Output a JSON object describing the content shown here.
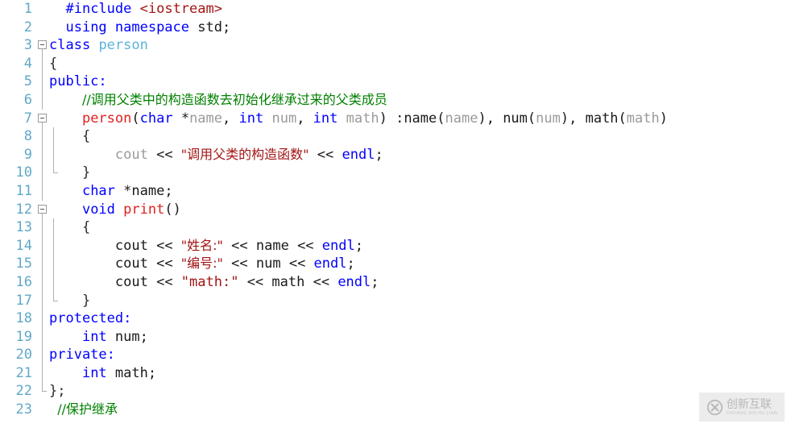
{
  "editor": {
    "language": "C++",
    "first_visible_line": 1,
    "last_visible_line": 23,
    "background_color": "#ffffff",
    "gutter_color": "#60a8c8",
    "colors": {
      "keyword": "#0000ff",
      "preprocessor": "#0000ff",
      "string": "#a31515",
      "comment": "#008000",
      "function": "#e02020",
      "type_name": "#5cb3d9",
      "identifier_gray": "#9a9a9a",
      "plain": "#1a1a1a",
      "fold_marker": "#9a9a9a"
    }
  },
  "lines": [
    {
      "number": "1",
      "fold": "none",
      "rail": "none",
      "tokens": [
        {
          "text": "  ",
          "cls": "t-plain"
        },
        {
          "text": "#include",
          "cls": "t-pre"
        },
        {
          "text": " ",
          "cls": "t-plain"
        },
        {
          "text": "<iostream>",
          "cls": "t-str"
        }
      ]
    },
    {
      "number": "2",
      "fold": "none",
      "rail": "none",
      "tokens": [
        {
          "text": "  ",
          "cls": "t-plain"
        },
        {
          "text": "using namespace",
          "cls": "t-kw"
        },
        {
          "text": " ",
          "cls": "t-plain"
        },
        {
          "text": "std",
          "cls": "t-plain"
        },
        {
          "text": ";",
          "cls": "t-plain"
        }
      ]
    },
    {
      "number": "3",
      "fold": "box",
      "rail": "none",
      "tokens": [
        {
          "text": "class",
          "cls": "t-kw"
        },
        {
          "text": " ",
          "cls": "t-plain"
        },
        {
          "text": "person",
          "cls": "t-type"
        }
      ]
    },
    {
      "number": "4",
      "fold": "line",
      "rail": "none",
      "tokens": [
        {
          "text": "{",
          "cls": "t-brace"
        }
      ]
    },
    {
      "number": "5",
      "fold": "line",
      "rail": "none",
      "tokens": [
        {
          "text": "public:",
          "cls": "t-kw"
        }
      ]
    },
    {
      "number": "6",
      "fold": "line",
      "rail": "none",
      "tokens": [
        {
          "text": "    ",
          "cls": "t-plain"
        },
        {
          "text": "//调用父类中的构造函数去初始化继承过来的父类成员",
          "cls": "t-cmt cjk"
        }
      ]
    },
    {
      "number": "7",
      "fold": "box",
      "rail": "none",
      "tokens": [
        {
          "text": "    ",
          "cls": "t-plain"
        },
        {
          "text": "person",
          "cls": "t-fn"
        },
        {
          "text": "(",
          "cls": "t-plain"
        },
        {
          "text": "char",
          "cls": "t-kw"
        },
        {
          "text": " *",
          "cls": "t-plain"
        },
        {
          "text": "name",
          "cls": "t-ident"
        },
        {
          "text": ", ",
          "cls": "t-plain"
        },
        {
          "text": "int",
          "cls": "t-kw"
        },
        {
          "text": " ",
          "cls": "t-plain"
        },
        {
          "text": "num",
          "cls": "t-ident"
        },
        {
          "text": ", ",
          "cls": "t-plain"
        },
        {
          "text": "int",
          "cls": "t-kw"
        },
        {
          "text": " ",
          "cls": "t-plain"
        },
        {
          "text": "math",
          "cls": "t-ident"
        },
        {
          "text": ") :",
          "cls": "t-plain"
        },
        {
          "text": "name",
          "cls": "t-plain"
        },
        {
          "text": "(",
          "cls": "t-plain"
        },
        {
          "text": "name",
          "cls": "t-ident"
        },
        {
          "text": "), ",
          "cls": "t-plain"
        },
        {
          "text": "num",
          "cls": "t-plain"
        },
        {
          "text": "(",
          "cls": "t-plain"
        },
        {
          "text": "num",
          "cls": "t-ident"
        },
        {
          "text": "), ",
          "cls": "t-plain"
        },
        {
          "text": "math",
          "cls": "t-plain"
        },
        {
          "text": "(",
          "cls": "t-plain"
        },
        {
          "text": "math",
          "cls": "t-ident"
        },
        {
          "text": ")",
          "cls": "t-plain"
        }
      ]
    },
    {
      "number": "8",
      "fold": "line",
      "rail": "line",
      "tokens": [
        {
          "text": "    {",
          "cls": "t-brace"
        }
      ]
    },
    {
      "number": "9",
      "fold": "line",
      "rail": "line",
      "tokens": [
        {
          "text": "        ",
          "cls": "t-plain"
        },
        {
          "text": "cout",
          "cls": "t-ident"
        },
        {
          "text": " << ",
          "cls": "t-plain"
        },
        {
          "text": "\"调用父类的构造函数\"",
          "cls": "t-str cjk"
        },
        {
          "text": " << ",
          "cls": "t-plain"
        },
        {
          "text": "endl",
          "cls": "t-kw"
        },
        {
          "text": ";",
          "cls": "t-plain"
        }
      ]
    },
    {
      "number": "10",
      "fold": "line",
      "rail": "tick",
      "tokens": [
        {
          "text": "    }",
          "cls": "t-brace"
        }
      ]
    },
    {
      "number": "11",
      "fold": "line",
      "rail": "none",
      "tokens": [
        {
          "text": "    ",
          "cls": "t-plain"
        },
        {
          "text": "char",
          "cls": "t-kw"
        },
        {
          "text": " *",
          "cls": "t-plain"
        },
        {
          "text": "name",
          "cls": "t-plain"
        },
        {
          "text": ";",
          "cls": "t-plain"
        }
      ]
    },
    {
      "number": "12",
      "fold": "box",
      "rail": "none",
      "tokens": [
        {
          "text": "    ",
          "cls": "t-plain"
        },
        {
          "text": "void",
          "cls": "t-kw"
        },
        {
          "text": " ",
          "cls": "t-plain"
        },
        {
          "text": "print",
          "cls": "t-fn"
        },
        {
          "text": "()",
          "cls": "t-plain"
        }
      ]
    },
    {
      "number": "13",
      "fold": "line",
      "rail": "line",
      "tokens": [
        {
          "text": "    {",
          "cls": "t-brace"
        }
      ]
    },
    {
      "number": "14",
      "fold": "line",
      "rail": "line",
      "tokens": [
        {
          "text": "        ",
          "cls": "t-plain"
        },
        {
          "text": "cout",
          "cls": "t-plain"
        },
        {
          "text": " << ",
          "cls": "t-plain"
        },
        {
          "text": "\"姓名:\"",
          "cls": "t-str cjk"
        },
        {
          "text": " << ",
          "cls": "t-plain"
        },
        {
          "text": "name",
          "cls": "t-plain"
        },
        {
          "text": " << ",
          "cls": "t-plain"
        },
        {
          "text": "endl",
          "cls": "t-kw"
        },
        {
          "text": ";",
          "cls": "t-plain"
        }
      ]
    },
    {
      "number": "15",
      "fold": "line",
      "rail": "line",
      "tokens": [
        {
          "text": "        ",
          "cls": "t-plain"
        },
        {
          "text": "cout",
          "cls": "t-plain"
        },
        {
          "text": " << ",
          "cls": "t-plain"
        },
        {
          "text": "\"编号:\"",
          "cls": "t-str cjk"
        },
        {
          "text": " << ",
          "cls": "t-plain"
        },
        {
          "text": "num",
          "cls": "t-plain"
        },
        {
          "text": " << ",
          "cls": "t-plain"
        },
        {
          "text": "endl",
          "cls": "t-kw"
        },
        {
          "text": ";",
          "cls": "t-plain"
        }
      ]
    },
    {
      "number": "16",
      "fold": "line",
      "rail": "line",
      "tokens": [
        {
          "text": "        ",
          "cls": "t-plain"
        },
        {
          "text": "cout",
          "cls": "t-plain"
        },
        {
          "text": " << ",
          "cls": "t-plain"
        },
        {
          "text": "\"math:\"",
          "cls": "t-str"
        },
        {
          "text": " << ",
          "cls": "t-plain"
        },
        {
          "text": "math",
          "cls": "t-plain"
        },
        {
          "text": " << ",
          "cls": "t-plain"
        },
        {
          "text": "endl",
          "cls": "t-kw"
        },
        {
          "text": ";",
          "cls": "t-plain"
        }
      ]
    },
    {
      "number": "17",
      "fold": "line",
      "rail": "tick",
      "tokens": [
        {
          "text": "    }",
          "cls": "t-brace"
        }
      ]
    },
    {
      "number": "18",
      "fold": "line",
      "rail": "none",
      "tokens": [
        {
          "text": "protected:",
          "cls": "t-kw"
        }
      ]
    },
    {
      "number": "19",
      "fold": "line",
      "rail": "none",
      "tokens": [
        {
          "text": "    ",
          "cls": "t-plain"
        },
        {
          "text": "int",
          "cls": "t-kw"
        },
        {
          "text": " ",
          "cls": "t-plain"
        },
        {
          "text": "num",
          "cls": "t-plain"
        },
        {
          "text": ";",
          "cls": "t-plain"
        }
      ]
    },
    {
      "number": "20",
      "fold": "line",
      "rail": "none",
      "tokens": [
        {
          "text": "private:",
          "cls": "t-kw"
        }
      ]
    },
    {
      "number": "21",
      "fold": "line",
      "rail": "none",
      "tokens": [
        {
          "text": "    ",
          "cls": "t-plain"
        },
        {
          "text": "int",
          "cls": "t-kw"
        },
        {
          "text": " ",
          "cls": "t-plain"
        },
        {
          "text": "math",
          "cls": "t-plain"
        },
        {
          "text": ";",
          "cls": "t-plain"
        }
      ]
    },
    {
      "number": "22",
      "fold": "tick",
      "rail": "none",
      "tokens": [
        {
          "text": "};",
          "cls": "t-brace"
        }
      ]
    },
    {
      "number": "23",
      "fold": "none",
      "rail": "none",
      "tokens": [
        {
          "text": " ",
          "cls": "t-plain"
        },
        {
          "text": "//保护继承",
          "cls": "t-cmt cjk"
        }
      ]
    }
  ],
  "watermark": {
    "logo_icon": "circled-x-icon",
    "title_cn": "创新互联",
    "title_en": "CHUANG XIN HU LIAN",
    "background_color": "#ebebeb",
    "text_color": "#b4b4b4"
  }
}
